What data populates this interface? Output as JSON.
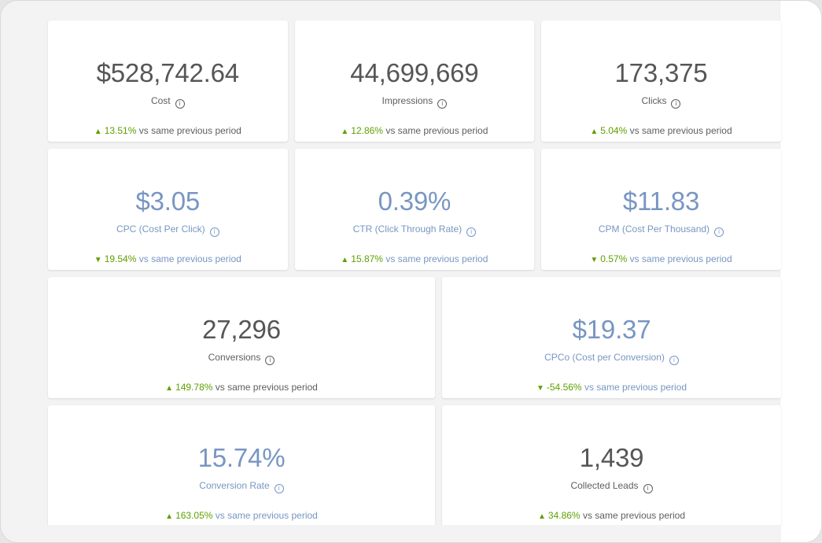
{
  "suffix": "vs same previous period",
  "cards": [
    {
      "value": "$528,742.64",
      "label": "Cost",
      "pct": "13.51%",
      "dir": "▲"
    },
    {
      "value": "44,699,669",
      "label": "Impressions",
      "pct": "12.86%",
      "dir": "▲"
    },
    {
      "value": "173,375",
      "label": "Clicks",
      "pct": "5.04%",
      "dir": "▲"
    },
    {
      "value": "$3.05",
      "label": "CPC (Cost Per Click)",
      "pct": "19.54%",
      "dir": "▼"
    },
    {
      "value": "0.39%",
      "label": "CTR (Click Through Rate)",
      "pct": "15.87%",
      "dir": "▲"
    },
    {
      "value": "$11.83",
      "label": "CPM (Cost Per Thousand)",
      "pct": "0.57%",
      "dir": "▼"
    },
    {
      "value": "27,296",
      "label": "Conversions",
      "pct": "149.78%",
      "dir": "▲"
    },
    {
      "value": "$19.37",
      "label": "CPCo (Cost per Conversion)",
      "pct": "-54.56%",
      "dir": "▼"
    },
    {
      "value": "15.74%",
      "label": "Conversion Rate",
      "pct": "163.05%",
      "dir": "▲"
    },
    {
      "value": "1,439",
      "label": "Collected Leads",
      "pct": "34.86%",
      "dir": "▲"
    }
  ],
  "colors": {
    "positive": "#5ea000",
    "metric_gray": "#565656",
    "metric_blue": "#7896c2"
  },
  "icons": {
    "info": "info-circle-icon"
  }
}
